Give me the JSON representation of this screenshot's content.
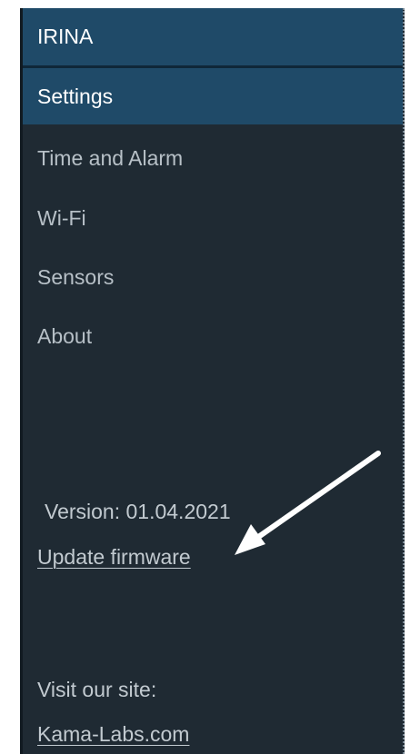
{
  "sidebar": {
    "brand": "IRINA",
    "items": [
      {
        "label": "Settings",
        "active": true
      },
      {
        "label": "Time and Alarm",
        "active": false
      },
      {
        "label": "Wi-Fi",
        "active": false
      },
      {
        "label": "Sensors",
        "active": false
      },
      {
        "label": "About",
        "active": false
      }
    ],
    "version": "Version: 01.04.2021",
    "update_link": "Update firmware",
    "visit_text": "Visit our site:",
    "site_link": "Kama-Labs.com"
  },
  "colors": {
    "sidebar_bg": "#1f2a33",
    "active_bg": "#1f4a68",
    "text": "#c2cad0",
    "active_text": "#ffffff"
  },
  "annotation": {
    "icon": "arrow-icon",
    "color": "#ffffff"
  }
}
